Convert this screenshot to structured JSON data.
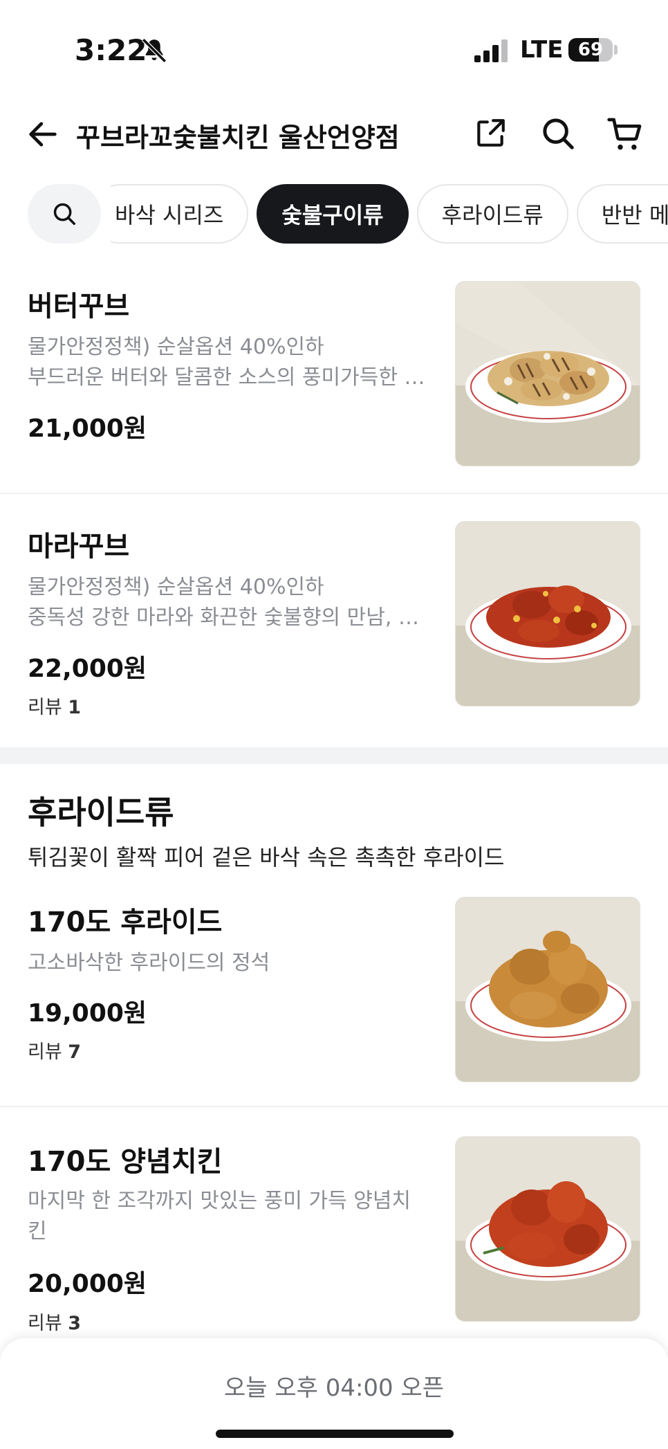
{
  "status_bar": {
    "time": "3:22",
    "network": "LTE",
    "battery": "69",
    "battery_level": 0.69
  },
  "header": {
    "title": "꾸브라꼬숯불치킨 울산언양점"
  },
  "tabs": [
    {
      "label": "바삭 시리즈",
      "active": false
    },
    {
      "label": "숯불구이류",
      "active": true
    },
    {
      "label": "후라이드류",
      "active": false
    },
    {
      "label": "반반 메뉴",
      "active": false
    }
  ],
  "items_top": [
    {
      "name": "버터꾸브",
      "desc1": "물가안정정책) 순살옵션 40%인하",
      "desc2": "부드러운 버터와 달콤한 소스의 풍미가득한 숯불치킨",
      "price": "21,000원"
    },
    {
      "name": "마라꾸브",
      "desc1": "물가안정정책) 순살옵션 40%인하",
      "desc2": "중독성 강한 마라와 화끈한 숯불향의 만남, 마라꾸브",
      "price": "22,000원",
      "review_label": "리뷰",
      "review_count": "1"
    }
  ],
  "section": {
    "title": "후라이드류",
    "desc": "튀김꽃이 활짝 피어 겉은 바삭 속은 촉촉한 후라이드"
  },
  "items_fried": [
    {
      "name": "170도 후라이드",
      "desc1": "고소바삭한 후라이드의 정석",
      "price": "19,000원",
      "review_label": "리뷰",
      "review_count": "7"
    },
    {
      "name": "170도 양념치킨",
      "desc1": "마지막 한 조각까지 맛있는 풍미 가득 양념치",
      "desc2": "킨",
      "price": "20,000원",
      "review_label": "리뷰",
      "review_count": "3"
    }
  ],
  "bottom_bar": {
    "open_text": "오늘 오후 04:00 오픈"
  },
  "colors": {
    "active_tab": "#16181b",
    "muted_text": "#8a8d93",
    "section_gap": "#f2f3f5"
  }
}
